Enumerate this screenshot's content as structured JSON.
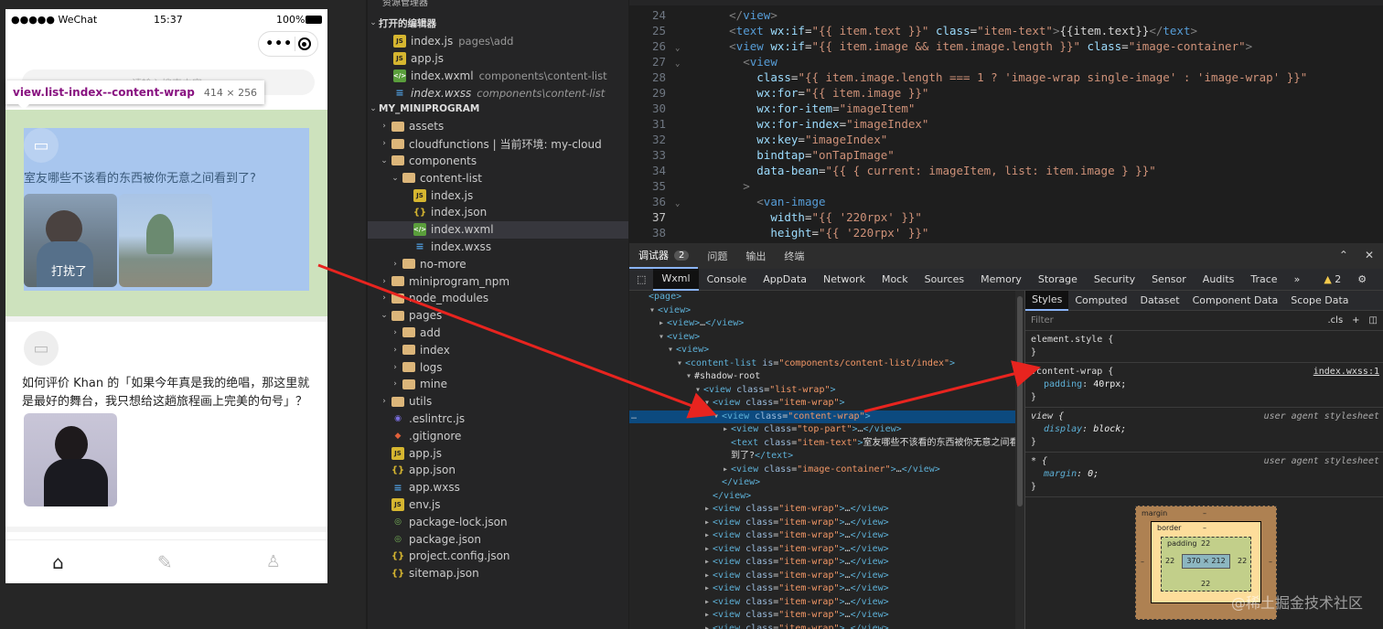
{
  "simulator": {
    "status_carrier": "●●●●● WeChat",
    "status_time": "15:37",
    "status_battery": "100%",
    "search_placeholder": "请输入搜索内容",
    "tooltip_class": "view.list-index--content-wrap",
    "tooltip_size": "414 × 256",
    "posts": [
      {
        "text": "室友哪些不该看的东西被你无意之间看到了?",
        "image_caption": "打扰了"
      },
      {
        "text": "如何评价 Khan 的「如果今年真是我的绝唱，那这里就是最好的舞台，我只想给这趟旅程画上完美的句号」？"
      }
    ],
    "tabbar_icons": [
      "home-icon",
      "edit-icon",
      "user-icon"
    ]
  },
  "explorer": {
    "header": "资源管理器",
    "open_editors_title": "打开的编辑器",
    "open_editors": [
      {
        "name": "index.js",
        "hint": "pages\\add",
        "type": "js"
      },
      {
        "name": "app.js",
        "hint": "",
        "type": "js"
      },
      {
        "name": "index.wxml",
        "hint": "components\\content-list",
        "type": "wxml"
      },
      {
        "name": "index.wxss",
        "hint": "components\\content-list",
        "type": "wxss"
      }
    ],
    "project_title": "MY_MINIPROGRAM",
    "tree": [
      {
        "name": "assets",
        "type": "folder",
        "depth": 1,
        "arrow": "›"
      },
      {
        "name": "cloudfunctions | 当前环境: my-cloud",
        "type": "folder",
        "depth": 1,
        "arrow": "›"
      },
      {
        "name": "components",
        "type": "folder",
        "depth": 1,
        "arrow": "⌄"
      },
      {
        "name": "content-list",
        "type": "folder",
        "depth": 2,
        "arrow": "⌄"
      },
      {
        "name": "index.js",
        "type": "js",
        "depth": 3,
        "arrow": ""
      },
      {
        "name": "index.json",
        "type": "json",
        "depth": 3,
        "arrow": ""
      },
      {
        "name": "index.wxml",
        "type": "wxml",
        "depth": 3,
        "arrow": ""
      },
      {
        "name": "index.wxss",
        "type": "wxss",
        "depth": 3,
        "arrow": ""
      },
      {
        "name": "no-more",
        "type": "folder",
        "depth": 2,
        "arrow": "›"
      },
      {
        "name": "miniprogram_npm",
        "type": "folder",
        "depth": 1,
        "arrow": "›"
      },
      {
        "name": "node_modules",
        "type": "folder",
        "depth": 1,
        "arrow": "›"
      },
      {
        "name": "pages",
        "type": "folder",
        "depth": 1,
        "arrow": "⌄"
      },
      {
        "name": "add",
        "type": "folder",
        "depth": 2,
        "arrow": "›"
      },
      {
        "name": "index",
        "type": "folder",
        "depth": 2,
        "arrow": "›"
      },
      {
        "name": "logs",
        "type": "folder",
        "depth": 2,
        "arrow": "›"
      },
      {
        "name": "mine",
        "type": "folder",
        "depth": 2,
        "arrow": "›"
      },
      {
        "name": "utils",
        "type": "folder",
        "depth": 1,
        "arrow": "›"
      },
      {
        "name": ".eslintrc.js",
        "type": "eslint",
        "depth": 1,
        "arrow": ""
      },
      {
        "name": ".gitignore",
        "type": "git",
        "depth": 1,
        "arrow": ""
      },
      {
        "name": "app.js",
        "type": "js",
        "depth": 1,
        "arrow": ""
      },
      {
        "name": "app.json",
        "type": "json",
        "depth": 1,
        "arrow": ""
      },
      {
        "name": "app.wxss",
        "type": "wxss",
        "depth": 1,
        "arrow": ""
      },
      {
        "name": "env.js",
        "type": "js",
        "depth": 1,
        "arrow": ""
      },
      {
        "name": "package-lock.json",
        "type": "lock",
        "depth": 1,
        "arrow": ""
      },
      {
        "name": "package.json",
        "type": "lock",
        "depth": 1,
        "arrow": ""
      },
      {
        "name": "project.config.json",
        "type": "json",
        "depth": 1,
        "arrow": ""
      },
      {
        "name": "sitemap.json",
        "type": "json",
        "depth": 1,
        "arrow": ""
      }
    ]
  },
  "editor": {
    "lines": [
      {
        "n": "24",
        "fold": "",
        "html": "<span class='t-pun'>      &lt;/</span><span class='t-tag'>view</span><span class='t-pun'>&gt;</span>"
      },
      {
        "n": "25",
        "fold": "",
        "html": "      <span class='t-pun'>&lt;</span><span class='t-tag'>text</span> <span class='t-attr'>wx:if</span>=<span class='t-str'>\"{{ item.text }}\"</span> <span class='t-attr'>class</span>=<span class='t-str'>\"item-text\"</span><span class='t-pun'>&gt;</span>{{item.text}}<span class='t-pun'>&lt;/</span><span class='t-tag'>text</span><span class='t-pun'>&gt;</span>"
      },
      {
        "n": "26",
        "fold": "⌄",
        "html": "      <span class='t-pun'>&lt;</span><span class='t-tag'>view</span> <span class='t-attr'>wx:if</span>=<span class='t-str'>\"{{ item.image &amp;&amp; item.image.length }}\"</span> <span class='t-attr'>class</span>=<span class='t-str'>\"image-container\"</span><span class='t-pun'>&gt;</span>"
      },
      {
        "n": "27",
        "fold": "⌄",
        "html": "        <span class='t-pun'>&lt;</span><span class='t-tag'>view</span>"
      },
      {
        "n": "28",
        "fold": "",
        "html": "          <span class='t-attr'>class</span>=<span class='t-str'>\"{{ item.image.length === 1 ? 'image-wrap single-image' : 'image-wrap' }}\"</span>"
      },
      {
        "n": "29",
        "fold": "",
        "html": "          <span class='t-attr'>wx:for</span>=<span class='t-str'>\"{{ item.image }}\"</span>"
      },
      {
        "n": "30",
        "fold": "",
        "html": "          <span class='t-attr'>wx:for-item</span>=<span class='t-str'>\"imageItem\"</span>"
      },
      {
        "n": "31",
        "fold": "",
        "html": "          <span class='t-attr'>wx:for-index</span>=<span class='t-str'>\"imageIndex\"</span>"
      },
      {
        "n": "32",
        "fold": "",
        "html": "          <span class='t-attr'>wx:key</span>=<span class='t-str'>\"imageIndex\"</span>"
      },
      {
        "n": "33",
        "fold": "",
        "html": "          <span class='t-attr'>bindtap</span>=<span class='t-str'>\"onTapImage\"</span>"
      },
      {
        "n": "34",
        "fold": "",
        "html": "          <span class='t-attr'>data-bean</span>=<span class='t-str'>\"{{ { current: imageItem, list: item.image } }}\"</span>"
      },
      {
        "n": "35",
        "fold": "",
        "html": "        <span class='t-pun'>&gt;</span>"
      },
      {
        "n": "36",
        "fold": "⌄",
        "html": "          <span class='t-pun'>&lt;</span><span class='t-tag'>van-image</span>"
      },
      {
        "n": "37",
        "fold": "",
        "html": "            <span class='t-attr'>width</span>=<span class='t-str'>\"{{ '220rpx' }}\"</span>"
      },
      {
        "n": "38",
        "fold": "",
        "html": "            <span class='t-attr'>height</span>=<span class='t-str'>\"{{ '220rpx' }}\"</span>"
      }
    ]
  },
  "devtools": {
    "top_tabs": [
      {
        "label": "调试器",
        "badge": "2"
      },
      {
        "label": "问题",
        "badge": ""
      },
      {
        "label": "输出",
        "badge": ""
      },
      {
        "label": "终端",
        "badge": ""
      }
    ],
    "panel_tabs": [
      "Wxml",
      "Console",
      "AppData",
      "Network",
      "Mock",
      "Sources",
      "Memory",
      "Storage",
      "Security",
      "Sensor",
      "Audits",
      "Trace"
    ],
    "warnings": "2",
    "dom_lines": [
      {
        "indent": 0,
        "arrow": "",
        "html": "<span class='d-tag'>&lt;page&gt;</span>"
      },
      {
        "indent": 1,
        "arrow": "▾",
        "html": "<span class='d-tag'>&lt;view&gt;</span>"
      },
      {
        "indent": 2,
        "arrow": "▸",
        "html": "<span class='d-tag'>&lt;view&gt;</span>…<span class='d-tag'>&lt;/view&gt;</span>"
      },
      {
        "indent": 2,
        "arrow": "▾",
        "html": "<span class='d-tag'>&lt;view&gt;</span>"
      },
      {
        "indent": 3,
        "arrow": "▾",
        "html": "<span class='d-tag'>&lt;view&gt;</span>"
      },
      {
        "indent": 4,
        "arrow": "▾",
        "html": "<span class='d-tag'>&lt;content-list </span><span class='d-attr'>is</span>=<span class='d-val'>\"components/content-list/index\"</span><span class='d-tag'>&gt;</span>"
      },
      {
        "indent": 5,
        "arrow": "▾",
        "html": "<span class='d-txt'>#shadow-root</span>"
      },
      {
        "indent": 6,
        "arrow": "▾",
        "html": "<span class='d-tag'>&lt;view </span><span class='d-attr'>class</span>=<span class='d-val'>\"list-wrap\"</span><span class='d-tag'>&gt;</span>"
      },
      {
        "indent": 7,
        "arrow": "▾",
        "html": "<span class='d-tag'>&lt;view </span><span class='d-attr'>class</span>=<span class='d-val'>\"item-wrap\"</span><span class='d-tag'>&gt;</span>"
      },
      {
        "indent": 8,
        "arrow": "▾",
        "html": "<span class='d-tag'>&lt;view </span><span class='d-attr'>class</span>=<span class='d-val'>\"content-wrap\"</span><span class='d-tag'>&gt;</span>",
        "selected": true
      },
      {
        "indent": 9,
        "arrow": "▸",
        "html": "<span class='d-tag'>&lt;view </span><span class='d-attr'>class</span>=<span class='d-val'>\"top-part\"</span><span class='d-tag'>&gt;</span>…<span class='d-tag'>&lt;/view&gt;</span>"
      },
      {
        "indent": 9,
        "arrow": "",
        "html": "<span class='d-tag'>&lt;text </span><span class='d-attr'>class</span>=<span class='d-val'>\"item-text\"</span><span class='d-tag'>&gt;</span><span class='d-txt'>室友哪些不该看的东西被你无意之间看</span>"
      },
      {
        "indent": 9,
        "arrow": "",
        "html": "<span class='d-txt'>到了?</span><span class='d-tag'>&lt;/text&gt;</span>"
      },
      {
        "indent": 9,
        "arrow": "▸",
        "html": "<span class='d-tag'>&lt;view </span><span class='d-attr'>class</span>=<span class='d-val'>\"image-container\"</span><span class='d-tag'>&gt;</span>…<span class='d-tag'>&lt;/view&gt;</span>"
      },
      {
        "indent": 8,
        "arrow": "",
        "html": "<span class='d-tag'>&lt;/view&gt;</span>"
      },
      {
        "indent": 7,
        "arrow": "",
        "html": "<span class='d-tag'>&lt;/view&gt;</span>"
      },
      {
        "indent": 7,
        "arrow": "▸",
        "html": "<span class='d-tag'>&lt;view </span><span class='d-attr'>class</span>=<span class='d-val'>\"item-wrap\"</span><span class='d-tag'>&gt;</span>…<span class='d-tag'>&lt;/view&gt;</span>"
      },
      {
        "indent": 7,
        "arrow": "▸",
        "html": "<span class='d-tag'>&lt;view </span><span class='d-attr'>class</span>=<span class='d-val'>\"item-wrap\"</span><span class='d-tag'>&gt;</span>…<span class='d-tag'>&lt;/view&gt;</span>"
      },
      {
        "indent": 7,
        "arrow": "▸",
        "html": "<span class='d-tag'>&lt;view </span><span class='d-attr'>class</span>=<span class='d-val'>\"item-wrap\"</span><span class='d-tag'>&gt;</span>…<span class='d-tag'>&lt;/view&gt;</span>"
      },
      {
        "indent": 7,
        "arrow": "▸",
        "html": "<span class='d-tag'>&lt;view </span><span class='d-attr'>class</span>=<span class='d-val'>\"item-wrap\"</span><span class='d-tag'>&gt;</span>…<span class='d-tag'>&lt;/view&gt;</span>"
      },
      {
        "indent": 7,
        "arrow": "▸",
        "html": "<span class='d-tag'>&lt;view </span><span class='d-attr'>class</span>=<span class='d-val'>\"item-wrap\"</span><span class='d-tag'>&gt;</span>…<span class='d-tag'>&lt;/view&gt;</span>"
      },
      {
        "indent": 7,
        "arrow": "▸",
        "html": "<span class='d-tag'>&lt;view </span><span class='d-attr'>class</span>=<span class='d-val'>\"item-wrap\"</span><span class='d-tag'>&gt;</span>…<span class='d-tag'>&lt;/view&gt;</span>"
      },
      {
        "indent": 7,
        "arrow": "▸",
        "html": "<span class='d-tag'>&lt;view </span><span class='d-attr'>class</span>=<span class='d-val'>\"item-wrap\"</span><span class='d-tag'>&gt;</span>…<span class='d-tag'>&lt;/view&gt;</span>"
      },
      {
        "indent": 7,
        "arrow": "▸",
        "html": "<span class='d-tag'>&lt;view </span><span class='d-attr'>class</span>=<span class='d-val'>\"item-wrap\"</span><span class='d-tag'>&gt;</span>…<span class='d-tag'>&lt;/view&gt;</span>"
      },
      {
        "indent": 7,
        "arrow": "▸",
        "html": "<span class='d-tag'>&lt;view </span><span class='d-attr'>class</span>=<span class='d-val'>\"item-wrap\"</span><span class='d-tag'>&gt;</span>…<span class='d-tag'>&lt;/view&gt;</span>"
      },
      {
        "indent": 7,
        "arrow": "▸",
        "html": "<span class='d-tag'>&lt;view </span><span class='d-attr'>class</span>=<span class='d-val'>\"item-wrap\"</span><span class='d-tag'>&gt;</span>…<span class='d-tag'>&lt;/view&gt;</span>"
      },
      {
        "indent": 7,
        "arrow": "▸",
        "html": "<span class='d-tag'>&lt;view </span><span class='d-attr'>class</span>=<span class='d-val'>\"item-wrap\"</span><span class='d-tag'>&gt;</span>…<span class='d-tag'>&lt;/view&gt;</span>"
      }
    ],
    "styles_tabs": [
      "Styles",
      "Computed",
      "Dataset",
      "Component Data",
      "Scope Data"
    ],
    "filter_placeholder": "Filter",
    "cls_label": ".cls",
    "rules": [
      {
        "selector": "element.style {",
        "source": "",
        "link": false,
        "props": [],
        "close": "}"
      },
      {
        "selector": ".content-wrap {",
        "source": "index.wxss:1",
        "link": true,
        "props": [
          {
            "name": "padding",
            "value": "40rpx;"
          }
        ],
        "close": "}"
      },
      {
        "selector": "view {",
        "source": "user agent stylesheet",
        "link": false,
        "props": [
          {
            "name": "display",
            "value": "block;"
          }
        ],
        "close": "}"
      },
      {
        "selector": "* {",
        "source": "user agent stylesheet",
        "link": false,
        "props": [
          {
            "name": "margin",
            "value": "0;"
          }
        ],
        "close": "}"
      }
    ],
    "box_model": {
      "margin_label": "margin",
      "margin_value": "–",
      "border_label": "border",
      "border_value": "–",
      "padding_label": "padding",
      "padding_top": "22",
      "padding_left": "22",
      "padding_right": "22",
      "padding_bottom": "22",
      "content_size": "370 × 212",
      "margin_left": "–",
      "margin_right": "–"
    }
  },
  "watermark": "@稀土掘金技术社区",
  "colors": {
    "highlight_green": "#cde2bd",
    "highlight_blue": "#a8c6ee",
    "selected_row": "#0c4a7f",
    "arrow_red": "#e8241f"
  }
}
